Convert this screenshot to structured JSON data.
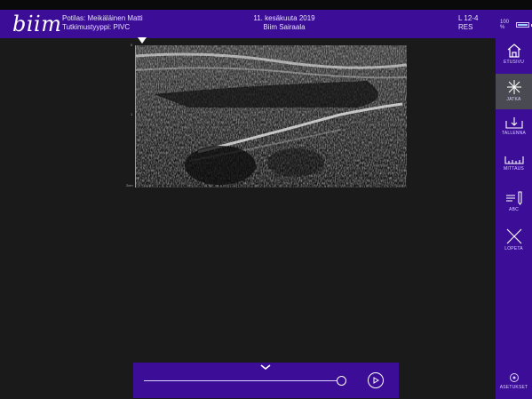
{
  "app": {
    "logo": "biim"
  },
  "header": {
    "patient_line": "Potilas: Meikäläinen Matti",
    "exam_type_line": "Tutkimustyyppi: PIVC",
    "date": "11. kesäkuuta 2019",
    "hospital": "Biim Sairaala",
    "probe": "L 12-4",
    "mode": "RES",
    "battery_text": "100 %",
    "battery_level": 1.0
  },
  "scan": {
    "depth_labels": [
      "0",
      "1",
      "2cm"
    ]
  },
  "sidebar": {
    "items": [
      {
        "label": "ETUSIVU",
        "icon": "home-icon"
      },
      {
        "label": "JATKA",
        "icon": "snowflake-icon"
      },
      {
        "label": "TALLENNA",
        "icon": "download-icon"
      },
      {
        "label": "MITTAUS",
        "icon": "ruler-icon"
      },
      {
        "label": "ABC",
        "icon": "text-pen-icon"
      },
      {
        "label": "LOPETA",
        "icon": "close-icon"
      },
      {
        "label": "ASETUKSET",
        "icon": "settings-icon"
      }
    ]
  },
  "playback": {
    "position": 1.0
  },
  "colors": {
    "brand": "#3c0d97",
    "background": "#1a1a1a",
    "active_item": "#4a4a52"
  }
}
